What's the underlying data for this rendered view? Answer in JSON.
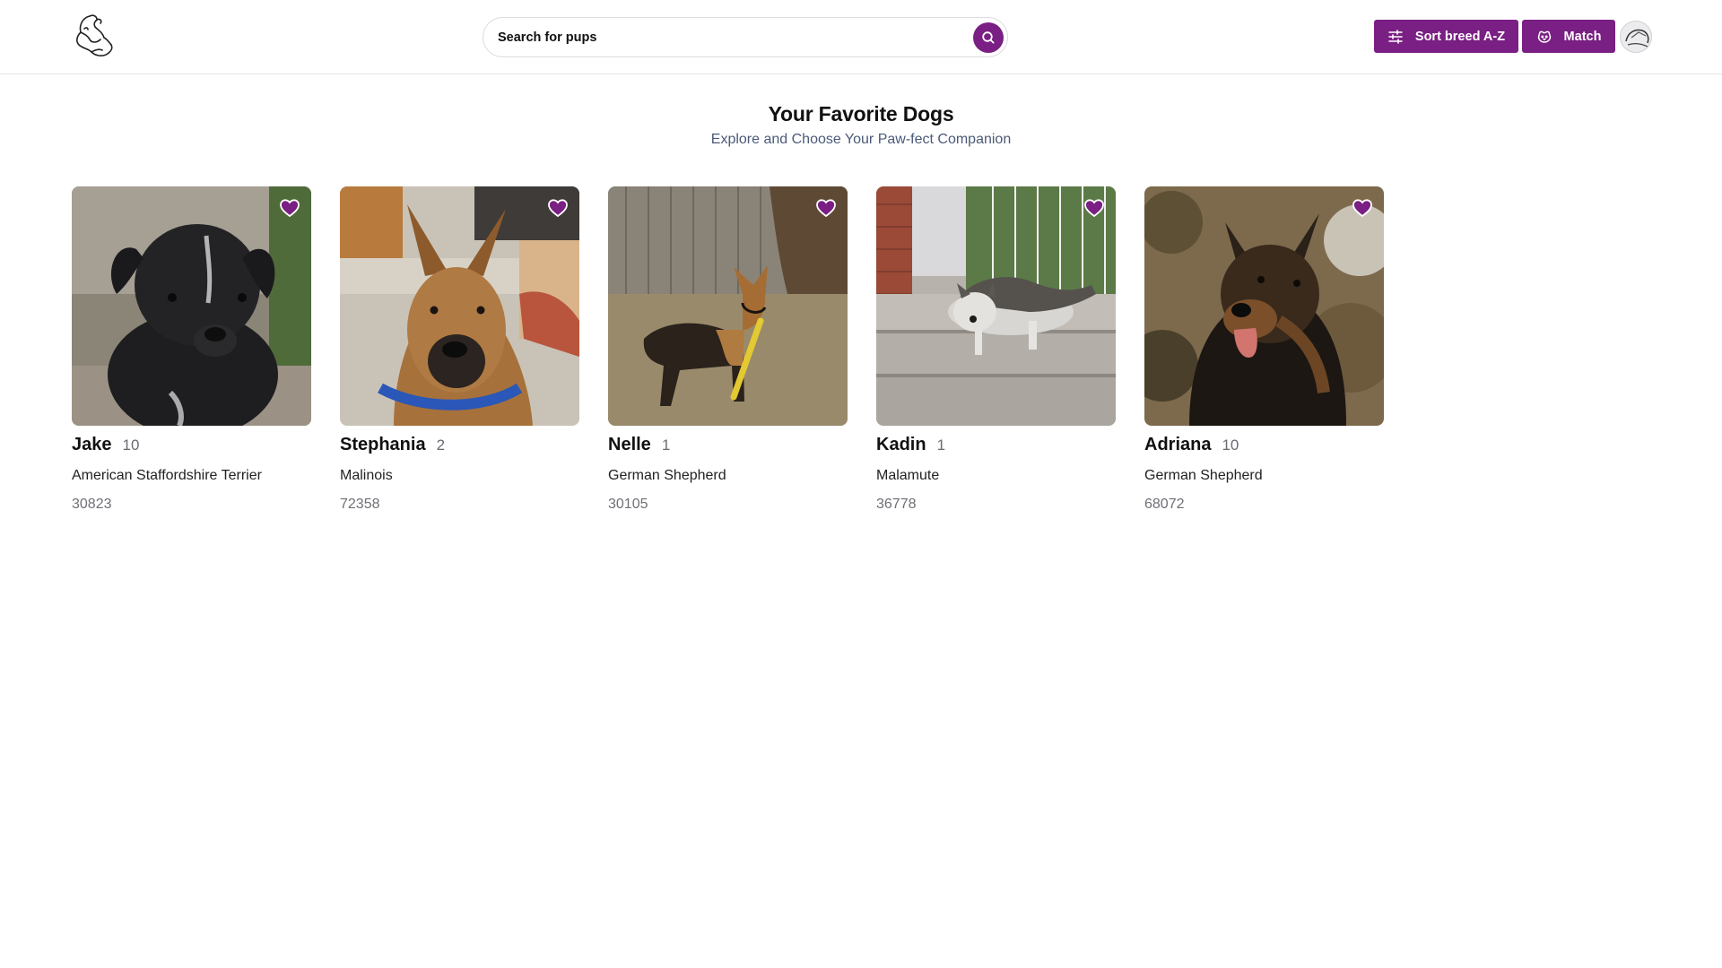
{
  "header": {
    "search": {
      "placeholder": "Search for pups",
      "value": ""
    },
    "sort_label": "Sort breed A-Z",
    "match_label": "Match"
  },
  "page": {
    "title": "Your Favorite Dogs",
    "subtitle": "Explore and Choose Your Paw-fect Companion"
  },
  "colors": {
    "accent": "#7a1f83",
    "subtitle": "#4b5a78"
  },
  "icons": {
    "logo": "dog-logo-icon",
    "search": "search-icon",
    "sort": "sliders-icon",
    "match": "dog-face-icon",
    "favorite": "heart-icon"
  },
  "dogs": [
    {
      "name": "Jake",
      "age": "10",
      "breed": "American Staffordshire Terrier",
      "zip": "30823",
      "favorited": true
    },
    {
      "name": "Stephania",
      "age": "2",
      "breed": "Malinois",
      "zip": "72358",
      "favorited": true
    },
    {
      "name": "Nelle",
      "age": "1",
      "breed": "German Shepherd",
      "zip": "30105",
      "favorited": true
    },
    {
      "name": "Kadin",
      "age": "1",
      "breed": "Malamute",
      "zip": "36778",
      "favorited": true
    },
    {
      "name": "Adriana",
      "age": "10",
      "breed": "German Shepherd",
      "zip": "68072",
      "favorited": true
    }
  ]
}
